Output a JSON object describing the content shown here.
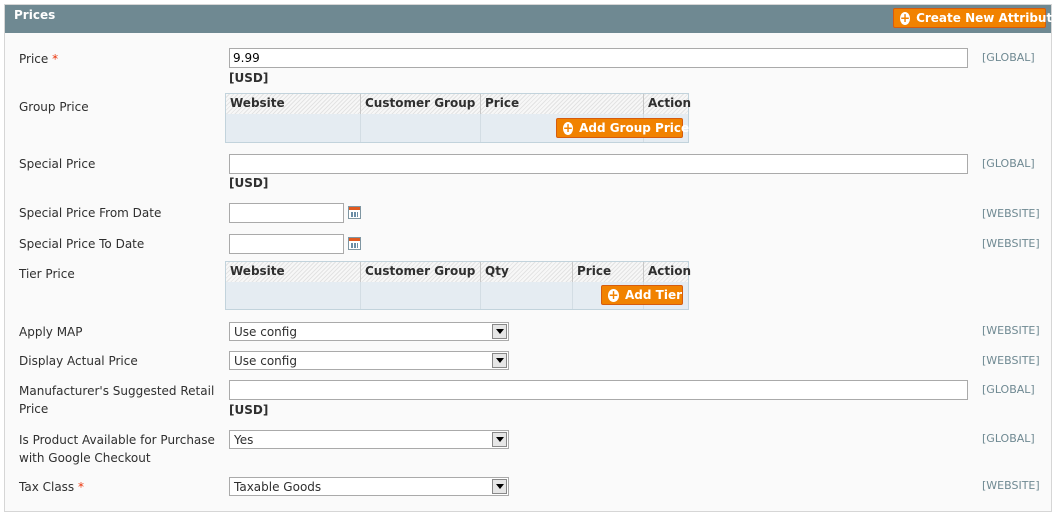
{
  "section": {
    "title": "Prices",
    "create_attribute_label": "Create New Attribute"
  },
  "fields": {
    "price": {
      "label": "Price",
      "required_mark": "*",
      "value": "9.99",
      "currency": "[USD]",
      "scope": "[GLOBAL]"
    },
    "group_price": {
      "label": "Group Price",
      "columns": [
        "Website",
        "Customer Group",
        "Price",
        "Action"
      ],
      "add_label": "Add Group Price"
    },
    "special_price": {
      "label": "Special Price",
      "value": "",
      "currency": "[USD]",
      "scope": "[GLOBAL]"
    },
    "special_from": {
      "label": "Special Price From Date",
      "value": "",
      "scope": "[WEBSITE]"
    },
    "special_to": {
      "label": "Special Price To Date",
      "value": "",
      "scope": "[WEBSITE]"
    },
    "tier_price": {
      "label": "Tier Price",
      "columns": [
        "Website",
        "Customer Group",
        "Qty",
        "Price",
        "Action"
      ],
      "add_label": "Add Tier"
    },
    "apply_map": {
      "label": "Apply MAP",
      "selected": "Use config",
      "scope": "[WEBSITE]"
    },
    "display_actual": {
      "label": "Display Actual Price",
      "selected": "Use config",
      "scope": "[WEBSITE]"
    },
    "msrp": {
      "label_line1": "Manufacturer's Suggested Retail",
      "label_line2": "Price",
      "value": "",
      "currency": "[USD]",
      "scope": "[GLOBAL]"
    },
    "google_checkout": {
      "label_line1": "Is Product Available for Purchase",
      "label_line2": "with Google Checkout",
      "selected": "Yes",
      "scope": "[GLOBAL]"
    },
    "tax_class": {
      "label": "Tax Class",
      "required_mark": "*",
      "selected": "Taxable Goods",
      "scope": "[WEBSITE]"
    }
  },
  "icons": {
    "add": "plus-circle-icon",
    "calendar": "calendar-icon",
    "dropdown": "chevron-down-icon"
  },
  "colors": {
    "header": "#6f8992",
    "button": "#f18200",
    "required": "#eb340a",
    "scope": "#6f8992"
  }
}
